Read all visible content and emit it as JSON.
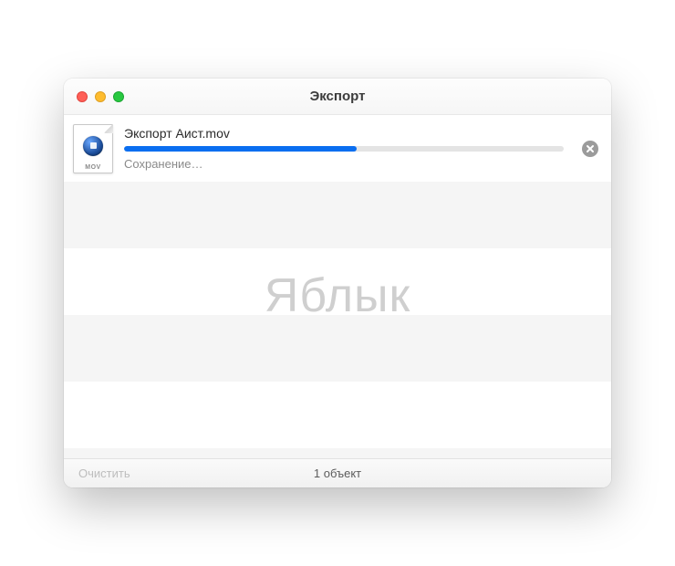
{
  "window": {
    "title": "Экспорт"
  },
  "item": {
    "filename": "Экспорт Аист.mov",
    "file_ext_label": "MOV",
    "status": "Сохранение…",
    "progress_percent": 53
  },
  "watermark": "Яблык",
  "footer": {
    "clear_label": "Очистить",
    "count_label": "1 объект"
  },
  "colors": {
    "progress": "#0a6ef0"
  }
}
